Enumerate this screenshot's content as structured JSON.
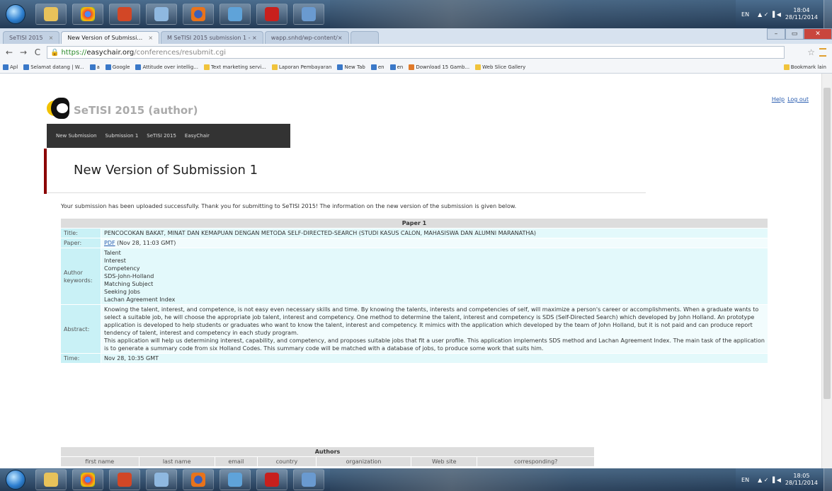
{
  "taskbar": {
    "apps": [
      "start",
      "explorer",
      "chrome",
      "powerpoint",
      "paint",
      "firefox",
      "media",
      "acrobat",
      "settings"
    ],
    "tray_lang": "EN",
    "top_clock": {
      "time": "18:04",
      "date": "28/11/2014"
    },
    "bottom_clock": {
      "time": "18:05",
      "date": "28/11/2014"
    }
  },
  "browser": {
    "tabs": [
      {
        "label": "SeTISI 2015",
        "active": false
      },
      {
        "label": "New Version of Submissi…",
        "active": true
      },
      {
        "label": "M SeTISI 2015 submission 1 - ×",
        "active": false
      },
      {
        "label": "wapp.snhd/wp-content/×",
        "active": false
      },
      {
        "label": "",
        "active": false
      }
    ],
    "url": {
      "scheme": "https://",
      "host": "easychair.org",
      "path": "/conferences/resubmit.cgi"
    },
    "bookmarks": [
      {
        "label": "Apl",
        "type": "app"
      },
      {
        "label": "Selamat datang | W...",
        "type": "page"
      },
      {
        "label": "a",
        "type": "page"
      },
      {
        "label": "Google",
        "type": "page"
      },
      {
        "label": "Attitude over intellig...",
        "type": "page"
      },
      {
        "label": "Text marketing servi...",
        "type": "folder"
      },
      {
        "label": "Laporan Pembayaran",
        "type": "folder"
      },
      {
        "label": "New Tab",
        "type": "page"
      },
      {
        "label": "en",
        "type": "page"
      },
      {
        "label": "en",
        "type": "page"
      },
      {
        "label": "Download 15 Gamb...",
        "type": "page"
      },
      {
        "label": "Web Slice Gallery",
        "type": "folder"
      }
    ],
    "bookmark_other": "Bookmark lain"
  },
  "page": {
    "conference": "SeTISI 2015 (author)",
    "help": "Help",
    "logout": "Log out",
    "menu": [
      "New Submission",
      "Submission 1",
      "SeTISI 2015",
      "EasyChair"
    ],
    "title": "New Version of Submission 1",
    "success_message": "Your submission has been uploaded successfully. Thank you for submitting to SeTISI 2015! The information on the new version of the submission is given below.",
    "paper": {
      "header": "Paper 1",
      "title_label": "Title:",
      "title": "PENCOCOKAN BAKAT, MINAT DAN KEMAPUAN DENGAN METODA SELF-DIRECTED-SEARCH (STUDI KASUS CALON, MAHASISWA DAN ALUMNI MARANATHA)",
      "paper_label": "Paper:",
      "pdf_link": "PDF",
      "paper_date": "(Nov 28, 11:03 GMT)",
      "keywords_label": "Author keywords:",
      "keywords": [
        "Talent",
        "Interest",
        "Competency",
        "SDS-John-Holland",
        "Matching Subject",
        "Seeking Jobs",
        "Lachan Agreement Index"
      ],
      "abstract_label": "Abstract:",
      "abstract_p1": "Knowing the talent, interest, and competence, is not easy even necessary skills and time. By knowing the talents, interests and competencies of self, will maximize a person's career or accomplishments. When a graduate wants to select a suitable job, he will choose the appropriate job talent, interest and competency. One method to determine the talent, interest and competency is SDS (Self-Directed Search) which developed by John Holland. An prototype application is developed to help students or graduates who want to know the talent, interest and competency. It mimics with the application which developed by the team of John Holland, but it is not paid and can produce report tendency of talent, interest and competency in each study program.",
      "abstract_p2": "This application will help us determining interest, capability, and competency, and proposes suitable jobs that fit a user profile. This application implements SDS method and Lachan Agreement Index. The main task of the application is to generate a summary code from six Holland Codes. This summary code will be matched with a database of jobs, to produce some work that suits him.",
      "time_label": "Time:",
      "time": "Nov 28, 10:35 GMT"
    },
    "authors": {
      "header": "Authors",
      "columns": [
        "first name",
        "last name",
        "email",
        "country",
        "organization",
        "Web site",
        "corresponding?"
      ]
    }
  }
}
